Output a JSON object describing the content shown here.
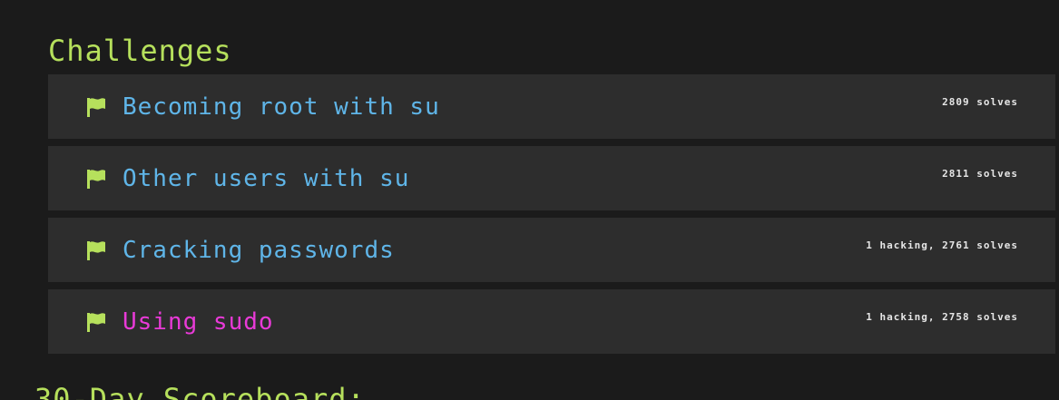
{
  "challenges_section": {
    "title": "Challenges",
    "items": [
      {
        "name": "Becoming root with su",
        "stats": "2809 solves",
        "state": "normal"
      },
      {
        "name": "Other users with su",
        "stats": "2811 solves",
        "state": "normal"
      },
      {
        "name": "Cracking passwords",
        "stats": "1 hacking, 2761 solves",
        "state": "normal"
      },
      {
        "name": "Using sudo",
        "stats": "1 hacking, 2758 solves",
        "state": "active"
      }
    ]
  },
  "scoreboard": {
    "title": "30-Day Scoreboard:"
  },
  "colors": {
    "background": "#1b1b1b",
    "card": "#2d2d2d",
    "heading": "#b6e05c",
    "link": "#5fb5e8",
    "active_link": "#e93ad8",
    "flag": "#b6e05c"
  },
  "icons": {
    "challenge_flag": "flag-icon"
  }
}
